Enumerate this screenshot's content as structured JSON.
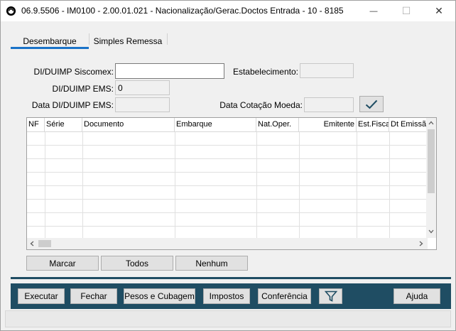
{
  "window": {
    "title": "06.9.5506 - IM0100 - 2.00.01.021 - Nacionalização/Gerac.Doctos Entrada - 10 - 8185",
    "minimize_glyph": "—",
    "maximize_glyph": "☐",
    "close_glyph": "✕"
  },
  "tabs": [
    {
      "label": "Desembarque",
      "active": true
    },
    {
      "label": "Simples Remessa",
      "active": false
    }
  ],
  "form": {
    "di_siscomex_label": "DI/DUIMP Siscomex:",
    "di_siscomex_value": "",
    "estabelecimento_label": "Estabelecimento:",
    "estabelecimento_value": "",
    "di_ems_label": "DI/DUIMP EMS:",
    "di_ems_value": "0",
    "data_di_ems_label": "Data DI/DUIMP EMS:",
    "data_di_ems_value": "",
    "data_cotacao_label": "Data Cotação Moeda:",
    "data_cotacao_value": ""
  },
  "grid": {
    "columns": [
      "NF",
      "Série",
      "Documento",
      "Embarque",
      "Nat.Oper.",
      "Emitente",
      "Est.Fisca",
      "Dt Emissão"
    ],
    "rows": []
  },
  "grid_buttons": {
    "marcar": "Marcar",
    "todos": "Todos",
    "nenhum": "Nenhum"
  },
  "toolbar": {
    "executar": "Executar",
    "fechar": "Fechar",
    "pesos": "Pesos e Cubagem",
    "impostos": "Impostos",
    "conferencia": "Conferência",
    "ajuda": "Ajuda"
  },
  "colors": {
    "toolbar_bg": "#1f4d63",
    "tab_accent": "#1a73c8",
    "check_color": "#1f4d63"
  }
}
